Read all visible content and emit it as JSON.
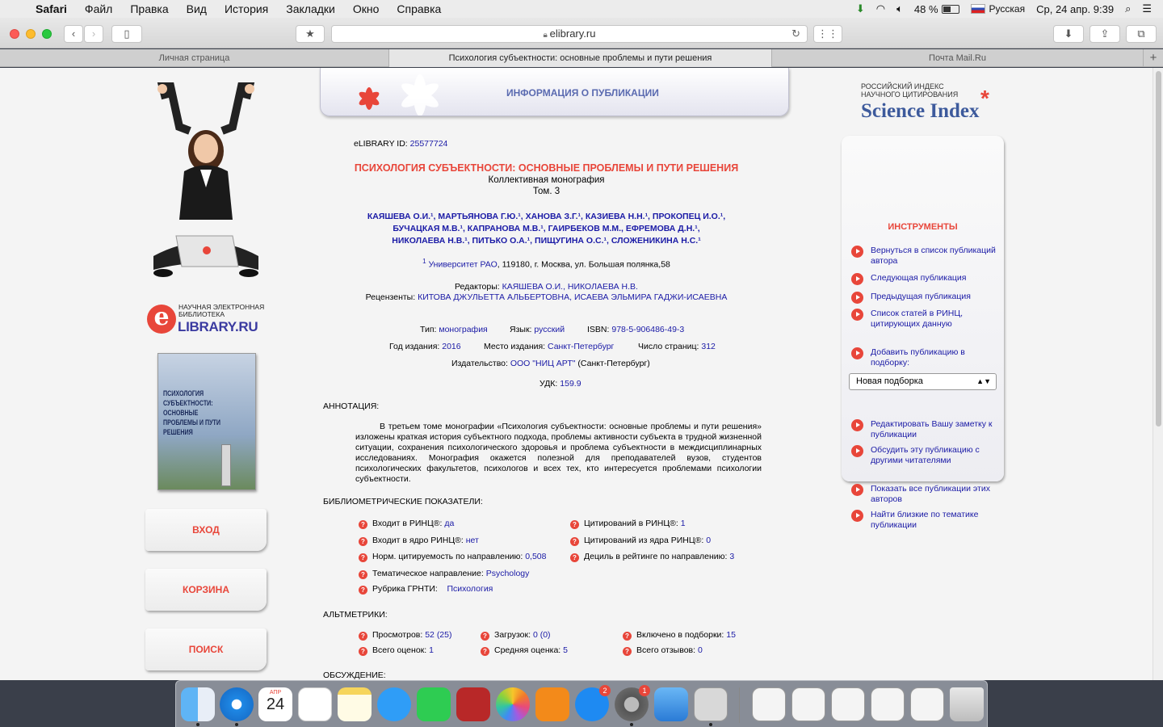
{
  "menubar": {
    "app": "Safari",
    "items": [
      "Файл",
      "Правка",
      "Вид",
      "История",
      "Закладки",
      "Окно",
      "Справка"
    ],
    "battery": "48 %",
    "language": "Русская",
    "datetime": "Ср, 24 апр. 9:39"
  },
  "toolbar": {
    "url": "elibrary.ru"
  },
  "tabs": [
    "Личная страница",
    "Психология субъектности: основные проблемы и пути решения",
    "Почта Mail.Ru"
  ],
  "header": {
    "title": "ИНФОРМАЦИЯ О ПУБЛИКАЦИИ"
  },
  "left": {
    "logo_line1": "НАУЧНАЯ ЭЛЕКТРОННАЯ БИБЛИОТЕКА",
    "logo_line2": "LIBRARY.RU",
    "cover_title": "ПСИХОЛОГИЯ СУБЪЕКТНОСТИ: ОСНОВНЫЕ ПРОБЛЕМЫ И ПУТИ РЕШЕНИЯ",
    "buttons": [
      "ВХОД",
      "КОРЗИНА",
      "ПОИСК"
    ]
  },
  "science_index": {
    "line1": "РОССИЙСКИЙ ИНДЕКС",
    "line2": "НАУЧНОГО ЦИТИРОВАНИЯ",
    "name": "Science Index"
  },
  "tools": {
    "title": "ИНСТРУМЕНТЫ",
    "items": [
      "Вернуться в список публикаций автора",
      "Следующая публикация",
      "Предыдущая публикация",
      "Список статей в РИНЦ, цитирующих данную",
      "Добавить публикацию в подборку:",
      "Редактировать Вашу заметку к публикации",
      "Обсудить эту публикацию с другими читателями",
      "Показать все публикации этих авторов",
      "Найти близкие по тематике публикации"
    ],
    "select": "Новая подборка"
  },
  "pub": {
    "id_label": "eLIBRARY ID:",
    "id": "25577724",
    "title": "ПСИХОЛОГИЯ СУБЪЕКТНОСТИ: ОСНОВНЫЕ ПРОБЛЕМЫ И ПУТИ РЕШЕНИЯ",
    "subtitle": "Коллективная монография",
    "volume": "Том. 3",
    "authors_line1": "КАЯШЕВА О.И.¹, МАРТЬЯНОВА Г.Ю.¹, ХАНОВА З.Г.¹, КАЗИЕВА Н.Н.¹, ПРОКОПЕЦ И.О.¹,",
    "authors_line2": "БУЧАЦКАЯ М.В.¹, КАПРАНОВА М.В.¹, ГАИРБЕКОВ М.М., ЕФРЕМОВА Д.Н.¹,",
    "authors_line3": "НИКОЛАЕВА Н.В.¹, ПИТЬКО О.А.¹, ПИЩУГИНА О.С.¹, СЛОЖЕНИКИНА Н.С.¹",
    "affil_sup": "1",
    "affil_org": "Университет РАО",
    "affil_addr": ", 119180, г. Москва, ул. Большая полянка,58",
    "editors_label": "Редакторы:",
    "editors": "КАЯШЕВА О.И., НИКОЛАЕВА Н.В.",
    "reviewers_label": "Рецензенты:",
    "reviewers": "КИТОВА ДЖУЛЬЕТТА АЛЬБЕРТОВНА, ИСАЕВА ЭЛЬМИРА ГАДЖИ-ИСАЕВНА",
    "type_label": "Тип:",
    "type": "монография",
    "lang_label": "Язык:",
    "lang": "русский",
    "isbn_label": "ISBN:",
    "isbn": "978-5-906486-49-3",
    "year_label": "Год издания:",
    "year": "2016",
    "place_label": "Место издания:",
    "place": "Санкт-Петербург",
    "pages_label": "Число страниц:",
    "pages": "312",
    "publisher_label": "Издательство:",
    "publisher": "ООО \"НИЦ АРТ\"",
    "publisher_city": " (Санкт-Петербург)",
    "udk_label": "УДК:",
    "udk": "159.9",
    "annotation_label": "АННОТАЦИЯ:",
    "annotation": "В третьем томе монографии «Психология субъектности: основные проблемы и пути решения» изложены краткая история субъектного подхода, проблемы активности субъекта в трудной жизненной ситуации, сохранения психологического здоровья и проблема субъектности в междисциплинарных исследованиях. Монография окажется полезной для преподавателей вузов, студентов психологических факультетов, психологов и всех тех, кто интересуется проблемами психологии субъектности.",
    "biblio_label": "БИБЛИОМЕТРИЧЕСКИЕ ПОКАЗАТЕЛИ:",
    "m1_label": "Входит в РИНЦ®:",
    "m1": "да",
    "m2_label": "Цитирований в РИНЦ®:",
    "m2": "1",
    "m3_label": "Входит в ядро РИНЦ®:",
    "m3": "нет",
    "m4_label": "Цитирований из ядра РИНЦ®:",
    "m4": "0",
    "m5_label": "Норм. цитируемость по направлению:",
    "m5": "0,508",
    "m6_label": "Дециль в рейтинге по направлению:",
    "m6": "3",
    "m7_label": "Тематическое направление:",
    "m7": "Psychology",
    "m8_label": "Рубрика ГРНТИ:",
    "m8": "Психология",
    "alt_label": "АЛЬТМЕТРИКИ:",
    "a1_label": "Просмотров:",
    "a1": "52 (25)",
    "a2_label": "Загрузок:",
    "a2": "0 (0)",
    "a3_label": "Включено в подборки:",
    "a3": "15",
    "a4_label": "Всего оценок:",
    "a4": "1",
    "a5_label": "Средняя оценка:",
    "a5": "5",
    "a6_label": "Всего отзывов:",
    "a6": "0",
    "discussion_label": "ОБСУЖДЕНИЕ:"
  },
  "dock": {
    "calendar_month": "АПР",
    "calendar_day": "24",
    "appstore_badge": "2",
    "prefs_badge": "1"
  }
}
